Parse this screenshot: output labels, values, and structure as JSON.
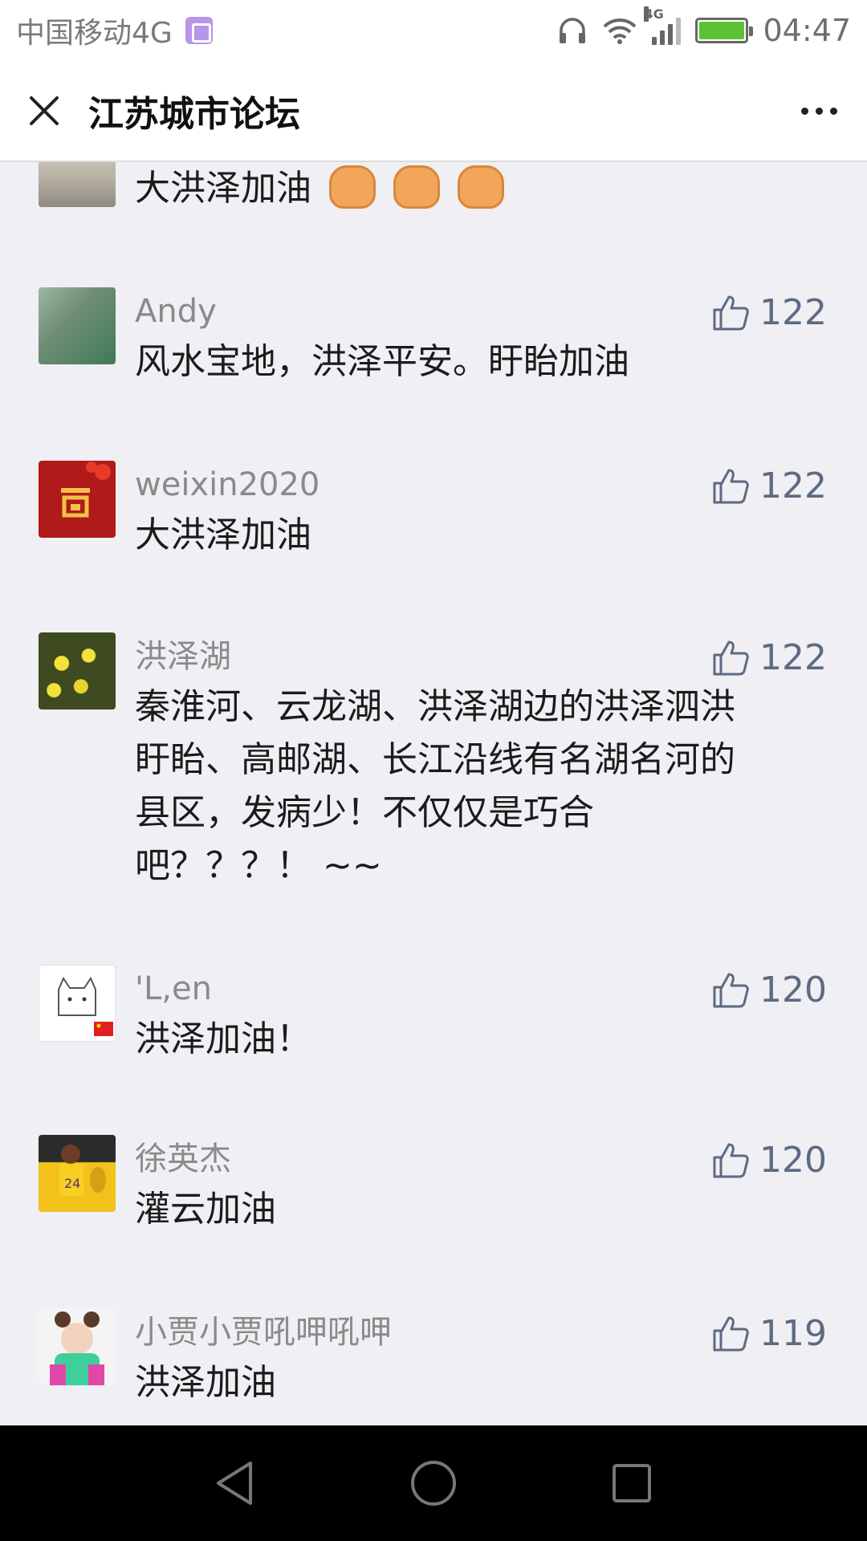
{
  "status_bar": {
    "carrier": "中国移动4G",
    "network_badge": "4G",
    "time": "04:47",
    "colors": {
      "battery": "#5bc236",
      "photo_icon": "#b895e6"
    }
  },
  "header": {
    "title": "江苏城市论坛"
  },
  "comments": [
    {
      "username": "",
      "text": "大洪泽加油",
      "emoji": "fist x3",
      "likes": ""
    },
    {
      "username": "Andy",
      "text": "风水宝地，洪泽平安。盱眙加油",
      "likes": "122"
    },
    {
      "username": "weixin2020",
      "text": "大洪泽加油",
      "likes": "122"
    },
    {
      "username": "洪泽湖",
      "text_lines": [
        "秦淮河、云龙湖、洪泽湖边的洪泽泗洪",
        "盱眙、高邮湖、长江沿线有名湖名河的",
        "县区，发病少！不仅仅是巧合",
        "吧？？？！ ~~"
      ],
      "likes": "122"
    },
    {
      "username": "'L,en",
      "text": "洪泽加油！",
      "likes": "120"
    },
    {
      "username": "徐英杰",
      "text": "灌云加油",
      "likes": "120"
    },
    {
      "username": "小贾小贾吼呷吼呷",
      "text": "洪泽加油",
      "likes": "119"
    }
  ],
  "colors": {
    "like": "#5d6a82",
    "username": "#8a8a8a",
    "background": "#efeff4"
  }
}
